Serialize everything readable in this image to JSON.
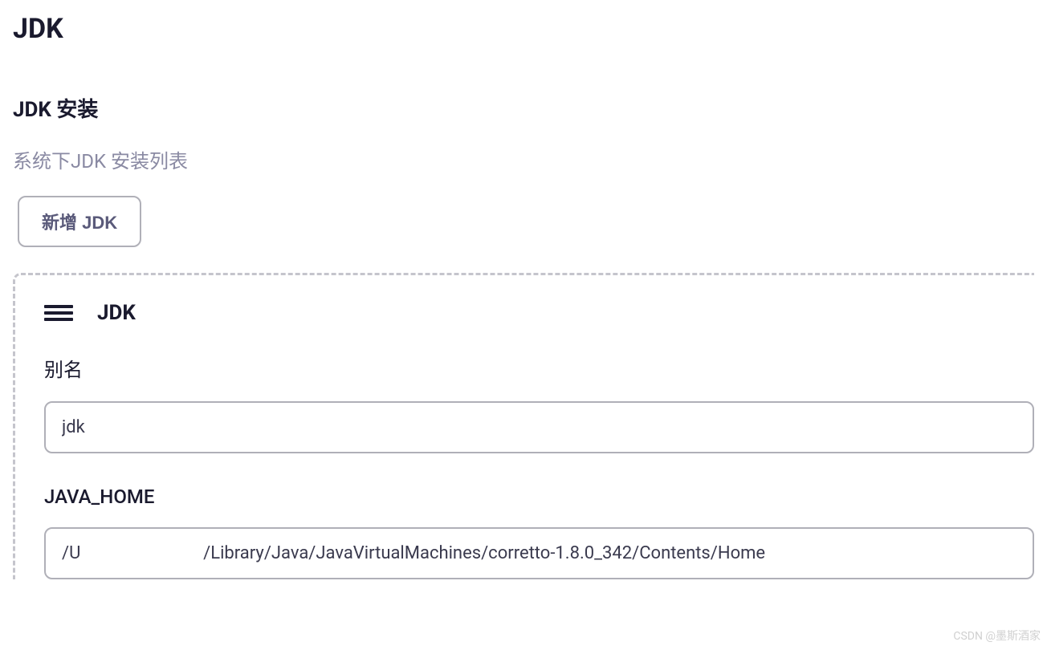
{
  "page": {
    "title": "JDK"
  },
  "section": {
    "title": "JDK 安装",
    "description": "系统下JDK 安装列表",
    "add_button_label": "新增 JDK"
  },
  "item": {
    "header_title": "JDK",
    "fields": {
      "alias": {
        "label": "别名",
        "value": "jdk"
      },
      "java_home": {
        "label": "JAVA_HOME",
        "value": "/U                            /Library/Java/JavaVirtualMachines/corretto-1.8.0_342/Contents/Home"
      }
    }
  },
  "watermark": "CSDN @墨斯酒家"
}
